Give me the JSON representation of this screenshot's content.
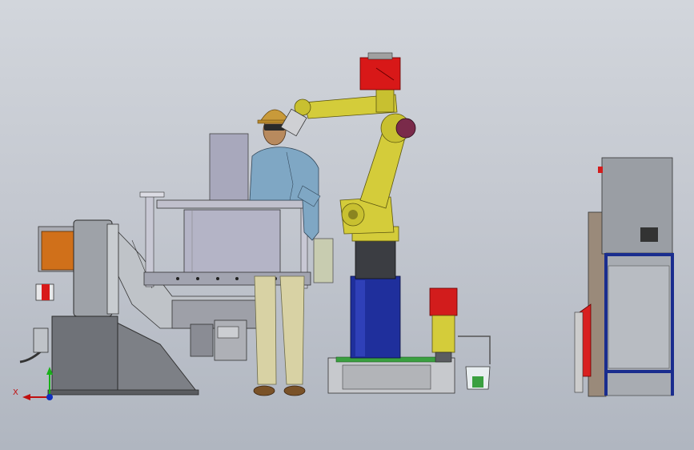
{
  "viewport": {
    "background_top": "#d2d6dc",
    "background_bottom": "#b0b6c0"
  },
  "colors": {
    "robot_yellow": "#d4cc3a",
    "robot_dark": "#3b3b2e",
    "gripper_red": "#d81818",
    "pedestal_blue": "#1f2f9c",
    "hopper_grey": "#b8b8c8",
    "worker_shirt": "#7fa7c4",
    "worker_pants": "#d8d2a4",
    "helmet": "#c89a3a",
    "hopper_orange": "#d0701a",
    "cabinet_grey": "#9a9ea4",
    "frame_blue": "#1a2d8e",
    "pump_red": "#d21c1c",
    "rail_green": "#3aa040"
  },
  "triad": {
    "x_label": "X",
    "y_axis_color": "#19b019",
    "x_axis_color": "#c01010",
    "z_axis_color": "#1030c0"
  }
}
